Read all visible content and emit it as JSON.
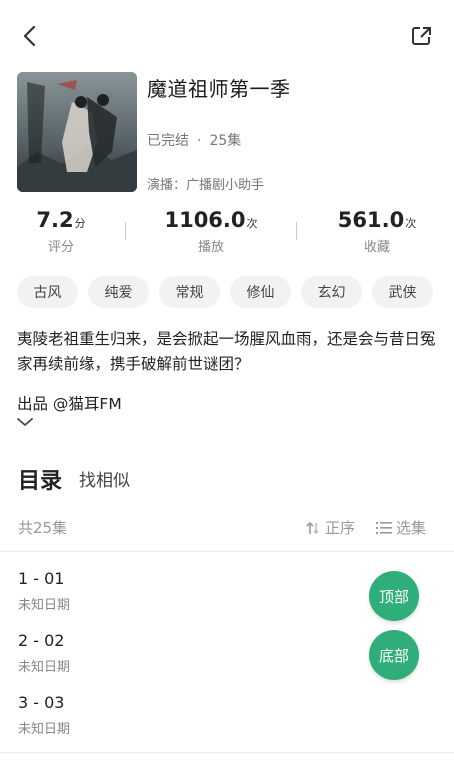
{
  "album": {
    "title": "魔道祖师第一季",
    "status": "已完结",
    "separator": "·",
    "episodes_count": "25集",
    "cast": "演播：广播剧小助手"
  },
  "stats": [
    {
      "value": "7.2",
      "unit": "分",
      "label": "评分"
    },
    {
      "value": "1106.0",
      "unit": "次",
      "label": "播放"
    },
    {
      "value": "561.0",
      "unit": "次",
      "label": "收藏"
    }
  ],
  "tags": [
    "古风",
    "纯爱",
    "常规",
    "修仙",
    "玄幻",
    "武侠"
  ],
  "description": "夷陵老祖重生归来，是会掀起一场腥风血雨，还是会与昔日冤家再续前缘，携手破解前世谜团？",
  "producer": "出品 @猫耳FM",
  "toc": {
    "title": "目录",
    "similar": "找相似",
    "count": "共25集",
    "sort_label": "正序",
    "select_label": "选集"
  },
  "episodes": [
    {
      "title": "1 - 01",
      "date": "未知日期"
    },
    {
      "title": "2 - 02",
      "date": "未知日期"
    },
    {
      "title": "3 - 03",
      "date": "未知日期"
    }
  ],
  "fabs": {
    "top": "顶部",
    "bottom": "底部"
  },
  "colors": {
    "accent": "#2fae7a"
  },
  "icons": {
    "back": "chevron-left-icon",
    "share": "share-icon",
    "expand": "chevron-down-icon",
    "sort": "sort-icon",
    "select": "list-icon"
  }
}
